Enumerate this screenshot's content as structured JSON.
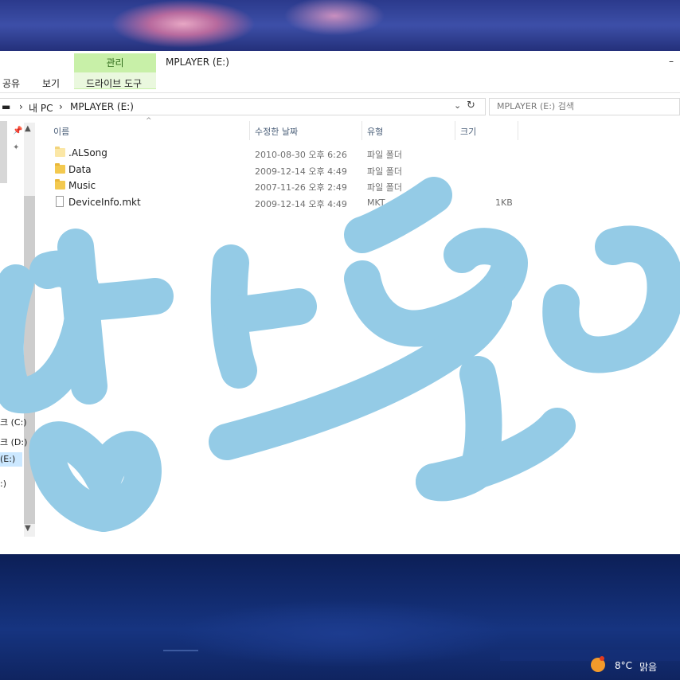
{
  "ribbon": {
    "context_tab": "관리",
    "context_subtab": "드라이브 도구",
    "tabs": [
      "공유",
      "보기"
    ],
    "window_title": "MPLAYER (E:)",
    "minimize_symbol": "–"
  },
  "address": {
    "path": [
      "내 PC",
      "MPLAYER (E:)"
    ],
    "separator": "›",
    "search_placeholder": "MPLAYER (E:) 검색"
  },
  "columns": {
    "name": "이름",
    "modified": "수정한 날짜",
    "type": "유형",
    "size": "크기"
  },
  "files": [
    {
      "name": ".ALSong",
      "modified": "2010-08-30 오후 6:26",
      "type": "파일 폴더",
      "size": "",
      "icon": "folder-hidden-icon"
    },
    {
      "name": "Data",
      "modified": "2009-12-14 오후 4:49",
      "type": "파일 폴더",
      "size": "",
      "icon": "folder-icon"
    },
    {
      "name": "Music",
      "modified": "2007-11-26 오후 2:49",
      "type": "파일 폴더",
      "size": "",
      "icon": "folder-icon"
    },
    {
      "name": "DeviceInfo.mkt",
      "modified": "2009-12-14 오후 4:49",
      "type": "MKT",
      "size": "1KB",
      "icon": "file-icon"
    }
  ],
  "nav": {
    "items": [
      "크 (C:)",
      "크 (D:)",
      "(E:)",
      ":)"
    ]
  },
  "status": {
    "temperature": "8°C",
    "condition": "맑음"
  },
  "colors": {
    "context_tab_bg": "#c8f0a8",
    "selection": "#cce8ff",
    "drawing_stroke": "#94cbe6",
    "folder": "#f3c94f"
  }
}
